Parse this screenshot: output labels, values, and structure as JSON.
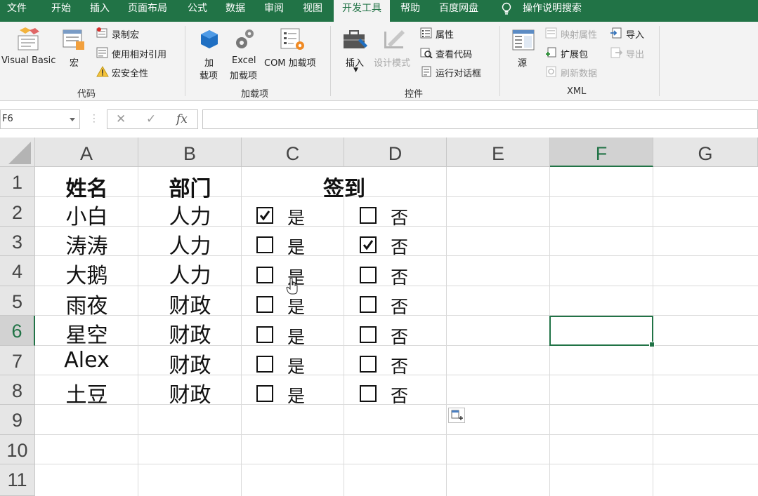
{
  "menu": {
    "tabs": [
      "文件",
      "开始",
      "插入",
      "页面布局",
      "公式",
      "数据",
      "审阅",
      "视图",
      "开发工具",
      "帮助",
      "百度网盘"
    ],
    "active_tab": "开发工具",
    "tell_me": "操作说明搜索"
  },
  "ribbon": {
    "code": {
      "visual_basic": "Visual Basic",
      "macros": "宏",
      "record_macro": "录制宏",
      "relative_refs": "使用相对引用",
      "macro_security": "宏安全性",
      "group": "代码"
    },
    "addins": {
      "addins_line1": "加",
      "addins_line2": "载项",
      "excel_line1": "Excel",
      "excel_line2": "加载项",
      "com": "COM 加载项",
      "group": "加载项"
    },
    "controls": {
      "insert": "插入",
      "design_mode": "设计模式",
      "properties": "属性",
      "view_code": "查看代码",
      "run_dialog": "运行对话框",
      "group": "控件"
    },
    "xml": {
      "source": "源",
      "map_props": "映射属性",
      "expansion": "扩展包",
      "refresh": "刷新数据",
      "import": "导入",
      "export": "导出",
      "group": "XML"
    }
  },
  "formula_bar": {
    "name_box": "F6",
    "cancel": "✕",
    "enter": "✓",
    "fx": "fx",
    "content": ""
  },
  "sheet": {
    "columns": [
      "A",
      "B",
      "C",
      "D",
      "E",
      "F",
      "G"
    ],
    "rows": [
      "1",
      "2",
      "3",
      "4",
      "5",
      "6",
      "7",
      "8",
      "9",
      "10",
      "11"
    ],
    "selected_cell": "F6",
    "header": {
      "name": "姓名",
      "dept": "部门",
      "signin": "签到"
    },
    "records": [
      {
        "name": "小白",
        "dept": "人力",
        "yes": "是",
        "no": "否",
        "yes_checked": true,
        "no_checked": false
      },
      {
        "name": "涛涛",
        "dept": "人力",
        "yes": "是",
        "no": "否",
        "yes_checked": false,
        "no_checked": true
      },
      {
        "name": "大鹅",
        "dept": "人力",
        "yes": "是",
        "no": "否",
        "yes_checked": false,
        "no_checked": false
      },
      {
        "name": "雨夜",
        "dept": "财政",
        "yes": "是",
        "no": "否",
        "yes_checked": false,
        "no_checked": false
      },
      {
        "name": "星空",
        "dept": "财政",
        "yes": "是",
        "no": "否",
        "yes_checked": false,
        "no_checked": false
      },
      {
        "name": "Alex",
        "dept": "财政",
        "yes": "是",
        "no": "否",
        "yes_checked": false,
        "no_checked": false
      },
      {
        "name": "土豆",
        "dept": "财政",
        "yes": "是",
        "no": "否",
        "yes_checked": false,
        "no_checked": false
      }
    ]
  },
  "colors": {
    "accent": "#217346",
    "ribbon_bg": "#f3f3f3",
    "header_bg": "#e6e6e6"
  }
}
